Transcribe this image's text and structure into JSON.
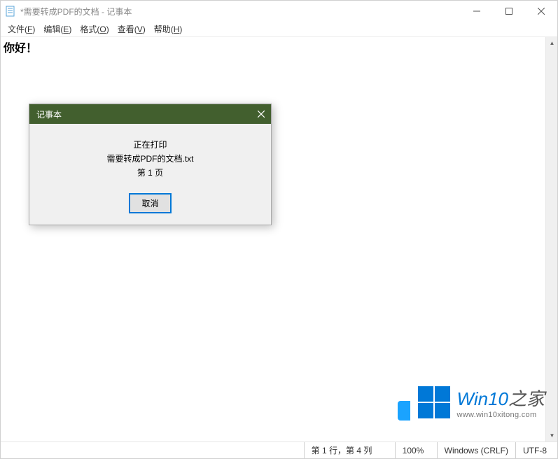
{
  "window": {
    "title": "*需要转成PDF的文档 - 记事本"
  },
  "menubar": {
    "file": "文件(F)",
    "edit": "编辑(E)",
    "format": "格式(O)",
    "view": "查看(V)",
    "help": "帮助(H)"
  },
  "editor": {
    "content": "你好！"
  },
  "dialog": {
    "title": "记事本",
    "line1": "正在打印",
    "line2": "需要转成PDF的文档.txt",
    "line3": "第 1 页",
    "cancel": "取消"
  },
  "statusbar": {
    "position": "第 1 行，第 4 列",
    "zoom": "100%",
    "eol": "Windows (CRLF)",
    "encoding": "UTF-8"
  },
  "watermark": {
    "brand_a": "Win10",
    "brand_b": "之家",
    "url": "www.win10xitong.com"
  }
}
